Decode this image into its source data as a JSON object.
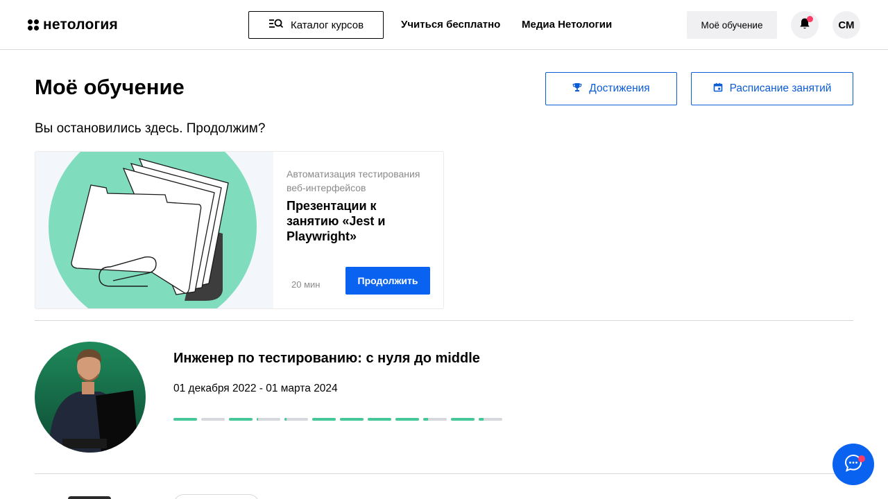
{
  "header": {
    "logo_text": "нетология",
    "catalog_label": "Каталог курсов",
    "nav": [
      "Учиться бесплатно",
      "Медиа Нетологии"
    ],
    "my_learning_label": "Моё обучение",
    "avatar_initials": "СМ",
    "has_notification": true
  },
  "page": {
    "title": "Моё обучение",
    "achievements_label": "Достижения",
    "schedule_label": "Расписание занятий",
    "resume_text": "Вы остановились здесь. Продолжим?"
  },
  "continue_card": {
    "course": "Автоматизация тестирования веб-интерфейсов",
    "lesson": "Презентации к занятию «Jest и Playwright»",
    "duration": "20 мин",
    "button_label": "Продолжить"
  },
  "program": {
    "title": "Инженер по тестированию: с нуля до middle",
    "dates": "01 декабря 2022 - 01 марта 2024",
    "progress_segments": [
      1,
      0,
      1,
      0.05,
      0.1,
      1,
      1,
      1,
      1,
      0.2,
      1,
      0.2
    ]
  },
  "colors": {
    "accent": "#0a63f0",
    "progress_done": "#46c797",
    "progress_todo": "#d5d8dd",
    "illustration_green": "#7fdcbc",
    "notification": "#ff3b66"
  }
}
